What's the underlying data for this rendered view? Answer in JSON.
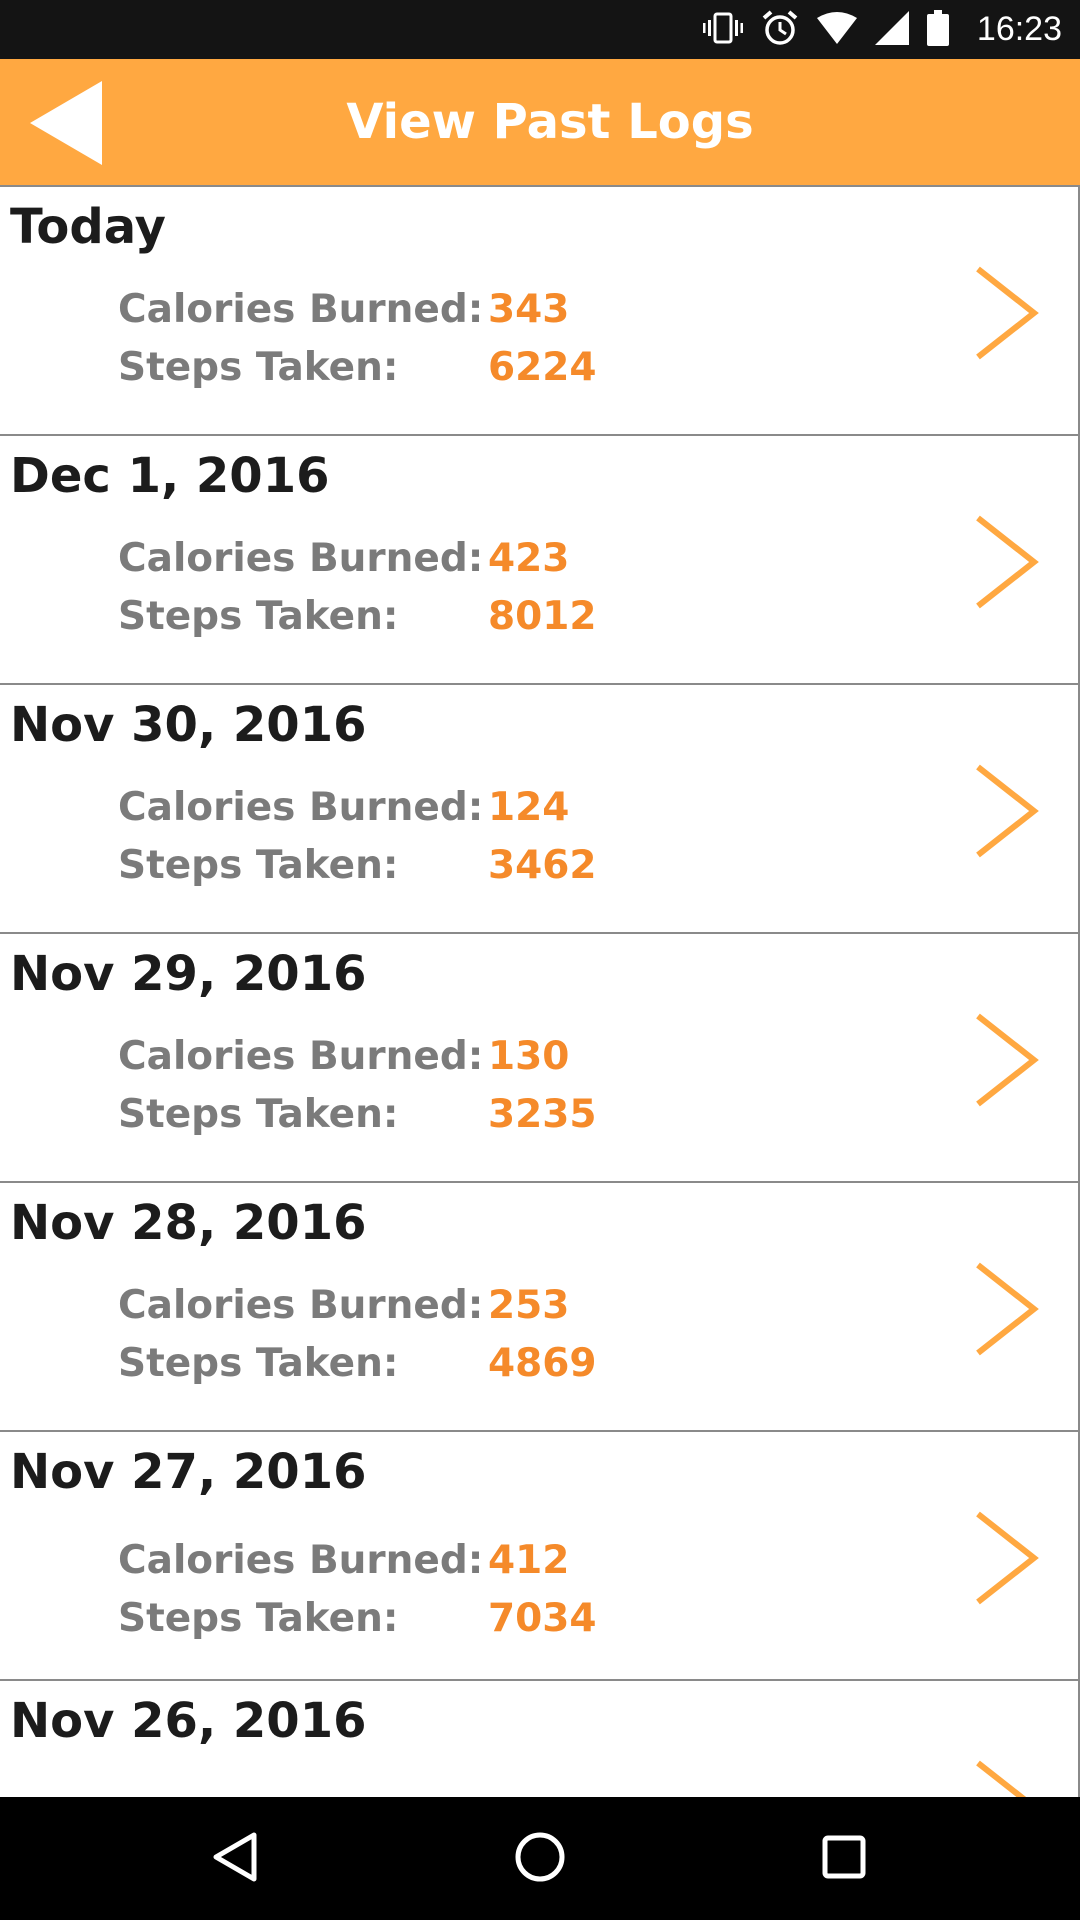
{
  "status_bar": {
    "time": "16:23",
    "icons": [
      "vibrate-icon",
      "alarm-icon",
      "wifi-icon",
      "signal-icon",
      "battery-icon"
    ]
  },
  "header": {
    "title": "View Past Logs",
    "back_icon": "back-arrow-icon"
  },
  "labels": {
    "calories": "Calories Burned:",
    "steps": "Steps Taken:"
  },
  "logs": [
    {
      "date": "Today",
      "calories": "343",
      "steps": "6224"
    },
    {
      "date": "Dec 1, 2016",
      "calories": "423",
      "steps": "8012"
    },
    {
      "date": "Nov 30, 2016",
      "calories": "124",
      "steps": "3462"
    },
    {
      "date": "Nov 29, 2016",
      "calories": "130",
      "steps": "3235"
    },
    {
      "date": "Nov 28, 2016",
      "calories": "253",
      "steps": "4869"
    },
    {
      "date": "Nov 27, 2016",
      "calories": "412",
      "steps": "7034"
    },
    {
      "date": "Nov 26, 2016"
    }
  ],
  "nav_bar": {
    "icons": [
      "back-triangle-icon",
      "home-circle-icon",
      "recents-square-icon"
    ]
  },
  "colors": {
    "accent": "#ffa841",
    "value": "#f58a2a",
    "label": "#7b7b7b"
  }
}
